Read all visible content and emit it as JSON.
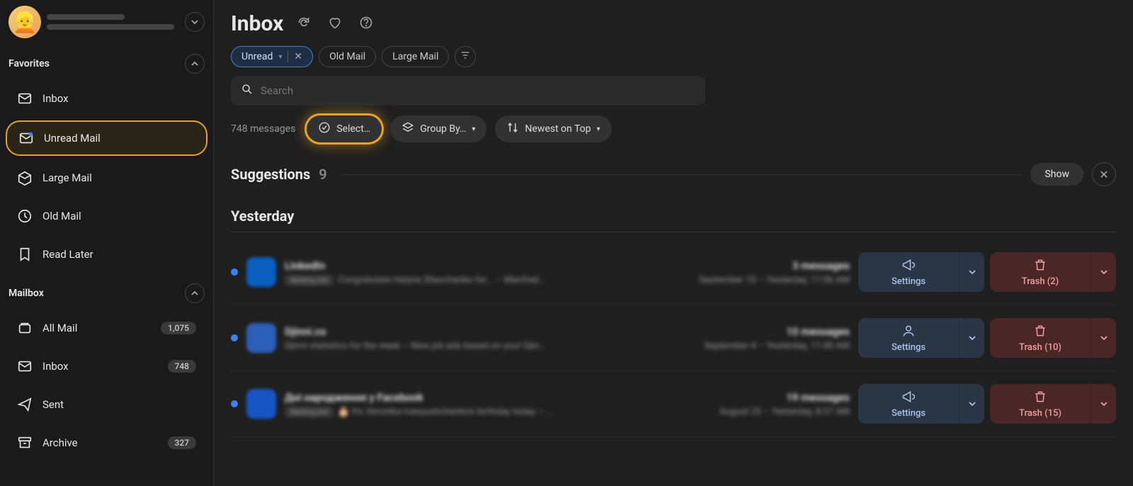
{
  "avatar_emoji": "👱",
  "sidebar": {
    "favorites_title": "Favorites",
    "mailbox_title": "Mailbox",
    "favorites": [
      {
        "label": "Inbox"
      },
      {
        "label": "Unread Mail"
      },
      {
        "label": "Large Mail"
      },
      {
        "label": "Old Mail"
      },
      {
        "label": "Read Later"
      }
    ],
    "mailbox": [
      {
        "label": "All Mail",
        "count": "1,075"
      },
      {
        "label": "Inbox",
        "count": "748"
      },
      {
        "label": "Sent"
      },
      {
        "label": "Archive",
        "count": "327"
      }
    ]
  },
  "header": {
    "title": "Inbox",
    "filters": {
      "unread": "Unread",
      "old_mail": "Old Mail",
      "large_mail": "Large Mail"
    },
    "search_placeholder": "Search",
    "message_count": "748 messages",
    "select_label": "Select…",
    "group_by_label": "Group By…",
    "sort_label": "Newest on Top"
  },
  "suggestions": {
    "title": "Suggestions",
    "count": "9",
    "show_label": "Show"
  },
  "group_title": "Yesterday",
  "rows": [
    {
      "avatar_bg": "#0a5fbf",
      "sender": "LinkedIn",
      "msg_count": "3 messages",
      "tag": "Mailing list",
      "subject": "Congratulate Halyna Shevchenko for... – Manfred...",
      "date": "September 10 – Yesterday, 11:06 AM",
      "settings_label": "Settings",
      "trash_label": "Trash (2)",
      "settings_icon": "megaphone"
    },
    {
      "avatar_bg": "#2b5fb8",
      "sender": "Djinni.co",
      "msg_count": "10 messages",
      "tag": "",
      "subject": "Djinni statistics for the week – New job ads based on your Djin...",
      "date": "September 4 – Yesterday, 11:00 AM",
      "settings_label": "Settings",
      "trash_label": "Trash (10)",
      "settings_icon": "user"
    },
    {
      "avatar_bg": "#1855c4",
      "sender": "Дні народження у Facebook",
      "msg_count": "19 messages",
      "tag": "Mailing list",
      "subject": "🎂 It's Veronika Ivanyushchenko's birthday today – ...",
      "date": "August 25 – Yesterday, 8:37 AM",
      "settings_label": "Settings",
      "trash_label": "Trash (15)",
      "settings_icon": "megaphone"
    }
  ]
}
